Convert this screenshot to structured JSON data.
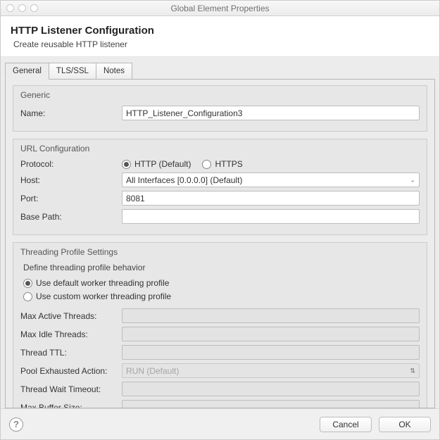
{
  "window": {
    "title": "Global Element Properties"
  },
  "header": {
    "title": "HTTP Listener Configuration",
    "subtitle": "Create reusable HTTP listener"
  },
  "tabs": [
    "General",
    "TLS/SSL",
    "Notes"
  ],
  "generic": {
    "legend": "Generic",
    "name_label": "Name:",
    "name_value": "HTTP_Listener_Configuration3"
  },
  "url": {
    "legend": "URL Configuration",
    "protocol_label": "Protocol:",
    "protocol_http": "HTTP (Default)",
    "protocol_https": "HTTPS",
    "host_label": "Host:",
    "host_value": "All Interfaces [0.0.0.0] (Default)",
    "port_label": "Port:",
    "port_value": "8081",
    "basepath_label": "Base Path:",
    "basepath_value": ""
  },
  "threading": {
    "legend": "Threading Profile Settings",
    "subhead": "Define threading profile behavior",
    "opt_default": "Use default worker threading profile",
    "opt_custom": "Use custom worker threading profile",
    "max_active_label": "Max Active Threads:",
    "max_idle_label": "Max Idle Threads:",
    "ttl_label": "Thread TTL:",
    "pool_label": "Pool Exhausted Action:",
    "pool_value": "RUN (Default)",
    "wait_label": "Thread Wait Timeout:",
    "buffer_label": "Max Buffer Size:"
  },
  "footer": {
    "cancel": "Cancel",
    "ok": "OK"
  }
}
